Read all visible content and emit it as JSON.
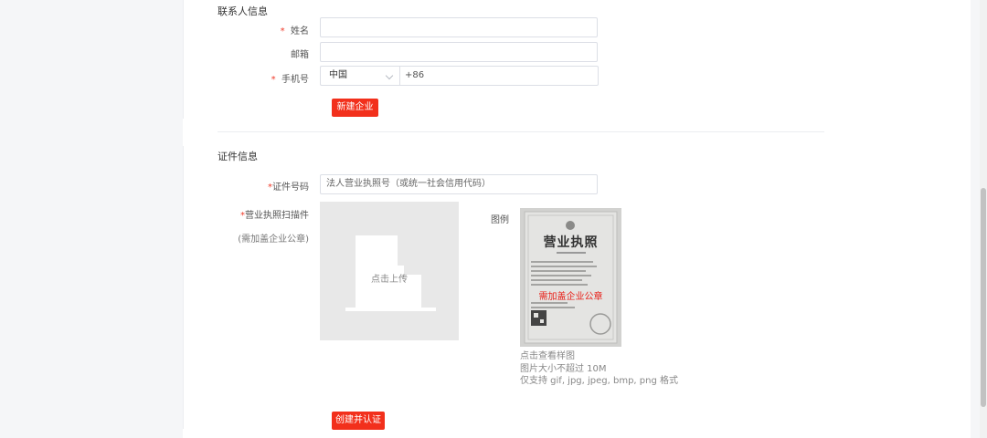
{
  "contact": {
    "title": "联系人信息",
    "name_label": "姓名",
    "email_label": "邮箱",
    "phone_label": "手机号",
    "country_value": "中国",
    "phone_prefix": "+86",
    "required_mark": "*",
    "create_button": "新建企业"
  },
  "certificate": {
    "title": "证件信息",
    "required_mark": "*",
    "number_label": "证件号码",
    "number_placeholder": "法人营业执照号（或统一社会信用代码）",
    "scan_label": "营业执照扫描件",
    "scan_hint": "(需加盖企业公章)",
    "upload_text": "点击上传",
    "sample_label": "图例",
    "sample_title": "营业执照",
    "sample_stamp_text": "需加盖企业公章",
    "view_sample": "点击查看样图",
    "size_limit": "图片大小不超过 10M",
    "formats": "仅支持 gif, jpg, jpeg, bmp, png 格式",
    "submit_button": "创建并认证"
  },
  "colors": {
    "accent": "#f2301c",
    "required": "#f03b2b"
  }
}
